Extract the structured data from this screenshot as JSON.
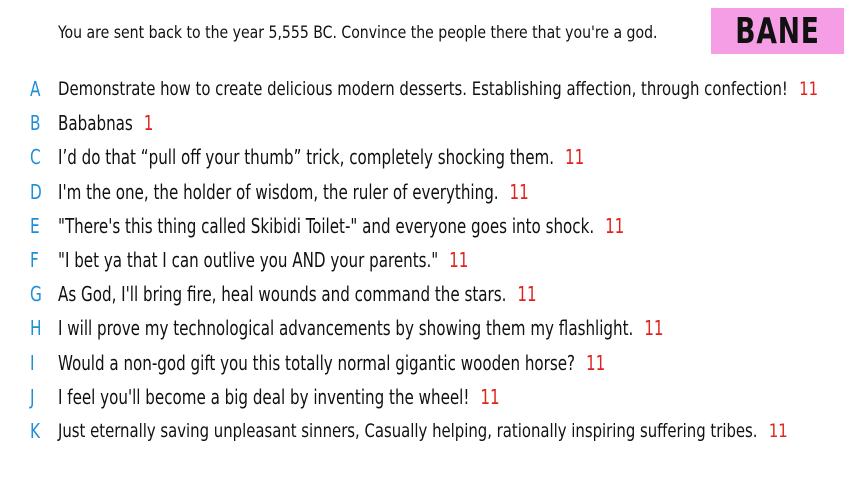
{
  "prompt": "You are sent back to the year 5,555 BC. Convince the people there that you're a god.",
  "tag": "BANE",
  "colors": {
    "letter": "#1e8ed8",
    "score": "#e0241d",
    "tag_bg": "#f59ee6",
    "text": "#111111"
  },
  "answers": [
    {
      "letter": "A",
      "text": "Demonstrate how to create delicious modern desserts. Establishing affection, through confection!",
      "score": "11"
    },
    {
      "letter": "B",
      "text": "Bababnas",
      "score": "1"
    },
    {
      "letter": "C",
      "text": "I’d do that “pull off your thumb” trick, completely shocking them.",
      "score": "11"
    },
    {
      "letter": "D",
      "text": "I'm the one, the holder of wisdom, the ruler of everything.",
      "score": "11"
    },
    {
      "letter": "E",
      "text": "\"There's this thing called Skibidi Toilet-\" and everyone goes into shock.",
      "score": "11"
    },
    {
      "letter": "F",
      "text": "\"I bet ya that I can outlive you AND your parents.\"",
      "score": "11"
    },
    {
      "letter": "G",
      "text": "As God, I'll bring fire, heal wounds and command the stars.",
      "score": "11"
    },
    {
      "letter": "H",
      "text": "I will prove my technological advancements by showing them my flashlight.",
      "score": "11"
    },
    {
      "letter": "I",
      "text": "Would a non-god gift you this totally normal gigantic wooden horse?",
      "score": "11"
    },
    {
      "letter": "J",
      "text": "I feel you'll become a big deal by inventing the wheel!",
      "score": "11"
    },
    {
      "letter": "K",
      "text": "Just eternally saving unpleasant sinners, Casually helping, rationally inspiring suffering tribes.",
      "score": "11"
    }
  ]
}
